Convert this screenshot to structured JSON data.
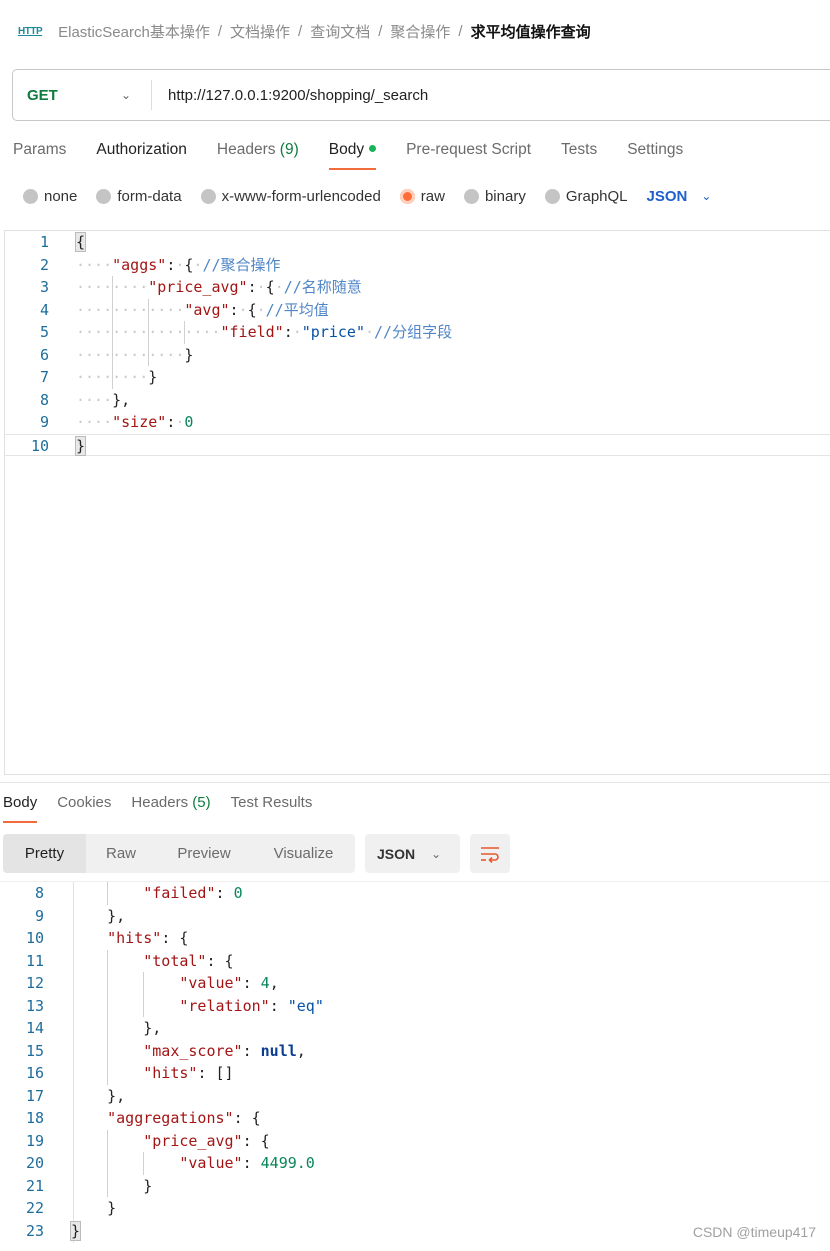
{
  "breadcrumb": {
    "icon": "HTTP",
    "items": [
      "ElasticSearch基本操作",
      "文档操作",
      "查询文档",
      "聚合操作"
    ],
    "current": "求平均值操作查询"
  },
  "request": {
    "method": "GET",
    "url": "http://127.0.0.1:9200/shopping/_search"
  },
  "req_tabs": {
    "params": "Params",
    "authorization": "Authorization",
    "headers": "Headers",
    "headers_count": "(9)",
    "body": "Body",
    "prerequest": "Pre-request Script",
    "tests": "Tests",
    "settings": "Settings"
  },
  "body_types": {
    "options": [
      "none",
      "form-data",
      "x-www-form-urlencoded",
      "raw",
      "binary",
      "GraphQL"
    ],
    "selected": "raw",
    "format": "JSON"
  },
  "request_body": [
    {
      "n": "1",
      "indent": 0,
      "t": [
        [
          "p",
          "{"
        ]
      ]
    },
    {
      "n": "2",
      "indent": 1,
      "t": [
        [
          "k",
          "\"aggs\""
        ],
        [
          "p",
          ":"
        ],
        [
          "w",
          "·"
        ],
        [
          "p",
          "{"
        ],
        [
          "w",
          "·"
        ],
        [
          "c",
          "//聚合操作"
        ]
      ]
    },
    {
      "n": "3",
      "indent": 2,
      "t": [
        [
          "k",
          "\"price_avg\""
        ],
        [
          "p",
          ":"
        ],
        [
          "w",
          "·"
        ],
        [
          "p",
          "{"
        ],
        [
          "w",
          "·"
        ],
        [
          "c",
          "//名称随意"
        ]
      ]
    },
    {
      "n": "4",
      "indent": 3,
      "t": [
        [
          "k",
          "\"avg\""
        ],
        [
          "p",
          ":"
        ],
        [
          "w",
          "·"
        ],
        [
          "p",
          "{"
        ],
        [
          "w",
          "·"
        ],
        [
          "c",
          "//平均值"
        ]
      ]
    },
    {
      "n": "5",
      "indent": 4,
      "t": [
        [
          "k",
          "\"field\""
        ],
        [
          "p",
          ":"
        ],
        [
          "w",
          "·"
        ],
        [
          "s",
          "\"price\""
        ],
        [
          "w",
          "·"
        ],
        [
          "c",
          "//分组字段"
        ]
      ]
    },
    {
      "n": "6",
      "indent": 3,
      "t": [
        [
          "p",
          "}"
        ]
      ]
    },
    {
      "n": "7",
      "indent": 2,
      "t": [
        [
          "p",
          "}"
        ]
      ]
    },
    {
      "n": "8",
      "indent": 1,
      "t": [
        [
          "p",
          "},"
        ]
      ]
    },
    {
      "n": "9",
      "indent": 1,
      "t": [
        [
          "k",
          "\"size\""
        ],
        [
          "p",
          ":"
        ],
        [
          "w",
          "·"
        ],
        [
          "n",
          "0"
        ]
      ]
    },
    {
      "n": "10",
      "indent": 0,
      "t": [
        [
          "p",
          "}"
        ]
      ]
    }
  ],
  "resp_tabs": {
    "body": "Body",
    "cookies": "Cookies",
    "headers": "Headers",
    "headers_count": "(5)",
    "tests": "Test Results"
  },
  "resp_view": {
    "options": [
      "Pretty",
      "Raw",
      "Preview",
      "Visualize"
    ],
    "selected": "Pretty",
    "format": "JSON"
  },
  "response_body": [
    {
      "n": "8",
      "indent": 2,
      "t": [
        [
          "k",
          "\"failed\""
        ],
        [
          "p",
          ": "
        ],
        [
          "n",
          "0"
        ]
      ]
    },
    {
      "n": "9",
      "indent": 1,
      "t": [
        [
          "p",
          "},"
        ]
      ]
    },
    {
      "n": "10",
      "indent": 1,
      "t": [
        [
          "k",
          "\"hits\""
        ],
        [
          "p",
          ": {"
        ]
      ]
    },
    {
      "n": "11",
      "indent": 2,
      "t": [
        [
          "k",
          "\"total\""
        ],
        [
          "p",
          ": {"
        ]
      ]
    },
    {
      "n": "12",
      "indent": 3,
      "t": [
        [
          "k",
          "\"value\""
        ],
        [
          "p",
          ": "
        ],
        [
          "n",
          "4"
        ],
        [
          "p",
          ","
        ]
      ]
    },
    {
      "n": "13",
      "indent": 3,
      "t": [
        [
          "k",
          "\"relation\""
        ],
        [
          "p",
          ": "
        ],
        [
          "s",
          "\"eq\""
        ]
      ]
    },
    {
      "n": "14",
      "indent": 2,
      "t": [
        [
          "p",
          "},"
        ]
      ]
    },
    {
      "n": "15",
      "indent": 2,
      "t": [
        [
          "k",
          "\"max_score\""
        ],
        [
          "p",
          ": "
        ],
        [
          "nl",
          "null"
        ],
        [
          "p",
          ","
        ]
      ]
    },
    {
      "n": "16",
      "indent": 2,
      "t": [
        [
          "k",
          "\"hits\""
        ],
        [
          "p",
          ": []"
        ]
      ]
    },
    {
      "n": "17",
      "indent": 1,
      "t": [
        [
          "p",
          "},"
        ]
      ]
    },
    {
      "n": "18",
      "indent": 1,
      "t": [
        [
          "k",
          "\"aggregations\""
        ],
        [
          "p",
          ": {"
        ]
      ]
    },
    {
      "n": "19",
      "indent": 2,
      "t": [
        [
          "k",
          "\"price_avg\""
        ],
        [
          "p",
          ": {"
        ]
      ]
    },
    {
      "n": "20",
      "indent": 3,
      "t": [
        [
          "k",
          "\"value\""
        ],
        [
          "p",
          ": "
        ],
        [
          "n",
          "4499.0"
        ]
      ]
    },
    {
      "n": "21",
      "indent": 2,
      "t": [
        [
          "p",
          "}"
        ]
      ]
    },
    {
      "n": "22",
      "indent": 1,
      "t": [
        [
          "p",
          "}"
        ]
      ]
    },
    {
      "n": "23",
      "indent": 0,
      "t": [
        [
          "p",
          "}"
        ]
      ]
    }
  ],
  "watermark": "CSDN @timeup417",
  "colors": {
    "accent": "#f26b3a",
    "method": "#0f7b3f",
    "json_link": "#1f5fcf"
  }
}
